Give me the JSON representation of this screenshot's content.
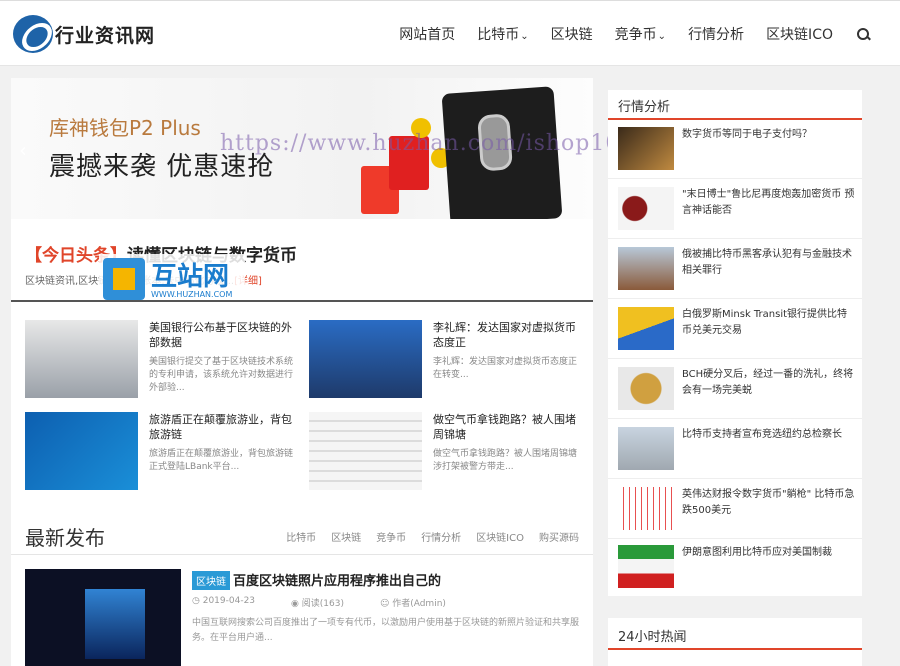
{
  "site": {
    "logo_text": "行业资讯网"
  },
  "nav": {
    "items": [
      {
        "label": "网站首页",
        "caret": false
      },
      {
        "label": "比特币",
        "caret": true
      },
      {
        "label": "区块链",
        "caret": false
      },
      {
        "label": "竞争币",
        "caret": true
      },
      {
        "label": "行情分析",
        "caret": false
      },
      {
        "label": "区块链ICO",
        "caret": false
      }
    ]
  },
  "slider": {
    "subtitle": "库神钱包P2 Plus",
    "title": "震撼来袭 优惠速抢",
    "prev_arrow": "‹"
  },
  "watermark": {
    "text": "https://www.huzhan.com/ishop10389"
  },
  "huzhan": {
    "name": "互站网",
    "url": "WWW.HUZHAN.COM"
  },
  "headline": {
    "tag": "【今日头条】",
    "title": "读懂区块链与数字货币",
    "desc": "区块链资讯,区块链                                                   数据库账本,去中心化协议...",
    "more": "[详细]"
  },
  "grid": [
    {
      "title": "美国银行公布基于区块链的外部数据",
      "desc": "美国银行提交了基于区块链技术系统的专利申请，该系统允许对数据进行外部验..."
    },
    {
      "title": "李礼辉：发达国家对虚拟货币态度正",
      "desc": "李礼辉：发达国家对虚拟货币态度正在转变..."
    },
    {
      "title": "旅游盾正在颠覆旅游业，背包旅游链",
      "desc": "旅游盾正在颠覆旅游业，背包旅游链正式登陆LBank平台..."
    },
    {
      "title": "做空气币拿钱跑路？被人围堵周锦塘",
      "desc": "做空气币拿钱跑路？被人围堵周锦塘涉打架被警方带走..."
    }
  ],
  "latest": {
    "title": "最新发布",
    "tabs": [
      "比特币",
      "区块链",
      "竞争币",
      "行情分析",
      "区块链ICO",
      "购买源码"
    ]
  },
  "post": {
    "category": "区块链",
    "title": "百度区块链照片应用程序推出自己的",
    "date": "2019-04-23",
    "views": "阅读(163)",
    "author": "作者(Admin)",
    "desc": "中国互联网搜索公司百度推出了一项专有代币，以激励用户使用基于区块链的新照片验证和共享服务。在平台用户通..."
  },
  "sidebar": {
    "title": "行情分析",
    "items": [
      {
        "text": "数字货币等同于电子支付吗？"
      },
      {
        "text": "\"末日博士\"鲁比尼再度炮轰加密货币 预言神话能否"
      },
      {
        "text": "俄被捕比特币黑客承认犯有与金融技术相关罪行"
      },
      {
        "text": "白俄罗斯Minsk Transit银行提供比特币兑美元交易"
      },
      {
        "text": "BCH硬分叉后，经过一番的洗礼，终将会有一场完美蜕"
      },
      {
        "text": "比特币支持者宣布竞选纽约总检察长"
      },
      {
        "text": "英伟达财报令数字货币\"躺枪\" 比特币急跌500美元"
      },
      {
        "text": "伊朗意图利用比特币应对美国制裁"
      }
    ]
  },
  "hot": {
    "title": "24小时热闻"
  },
  "colors": {
    "accent": "#e0452a",
    "tag_blue": "#2a9ad6",
    "logo_blue": "#1e63a8"
  }
}
